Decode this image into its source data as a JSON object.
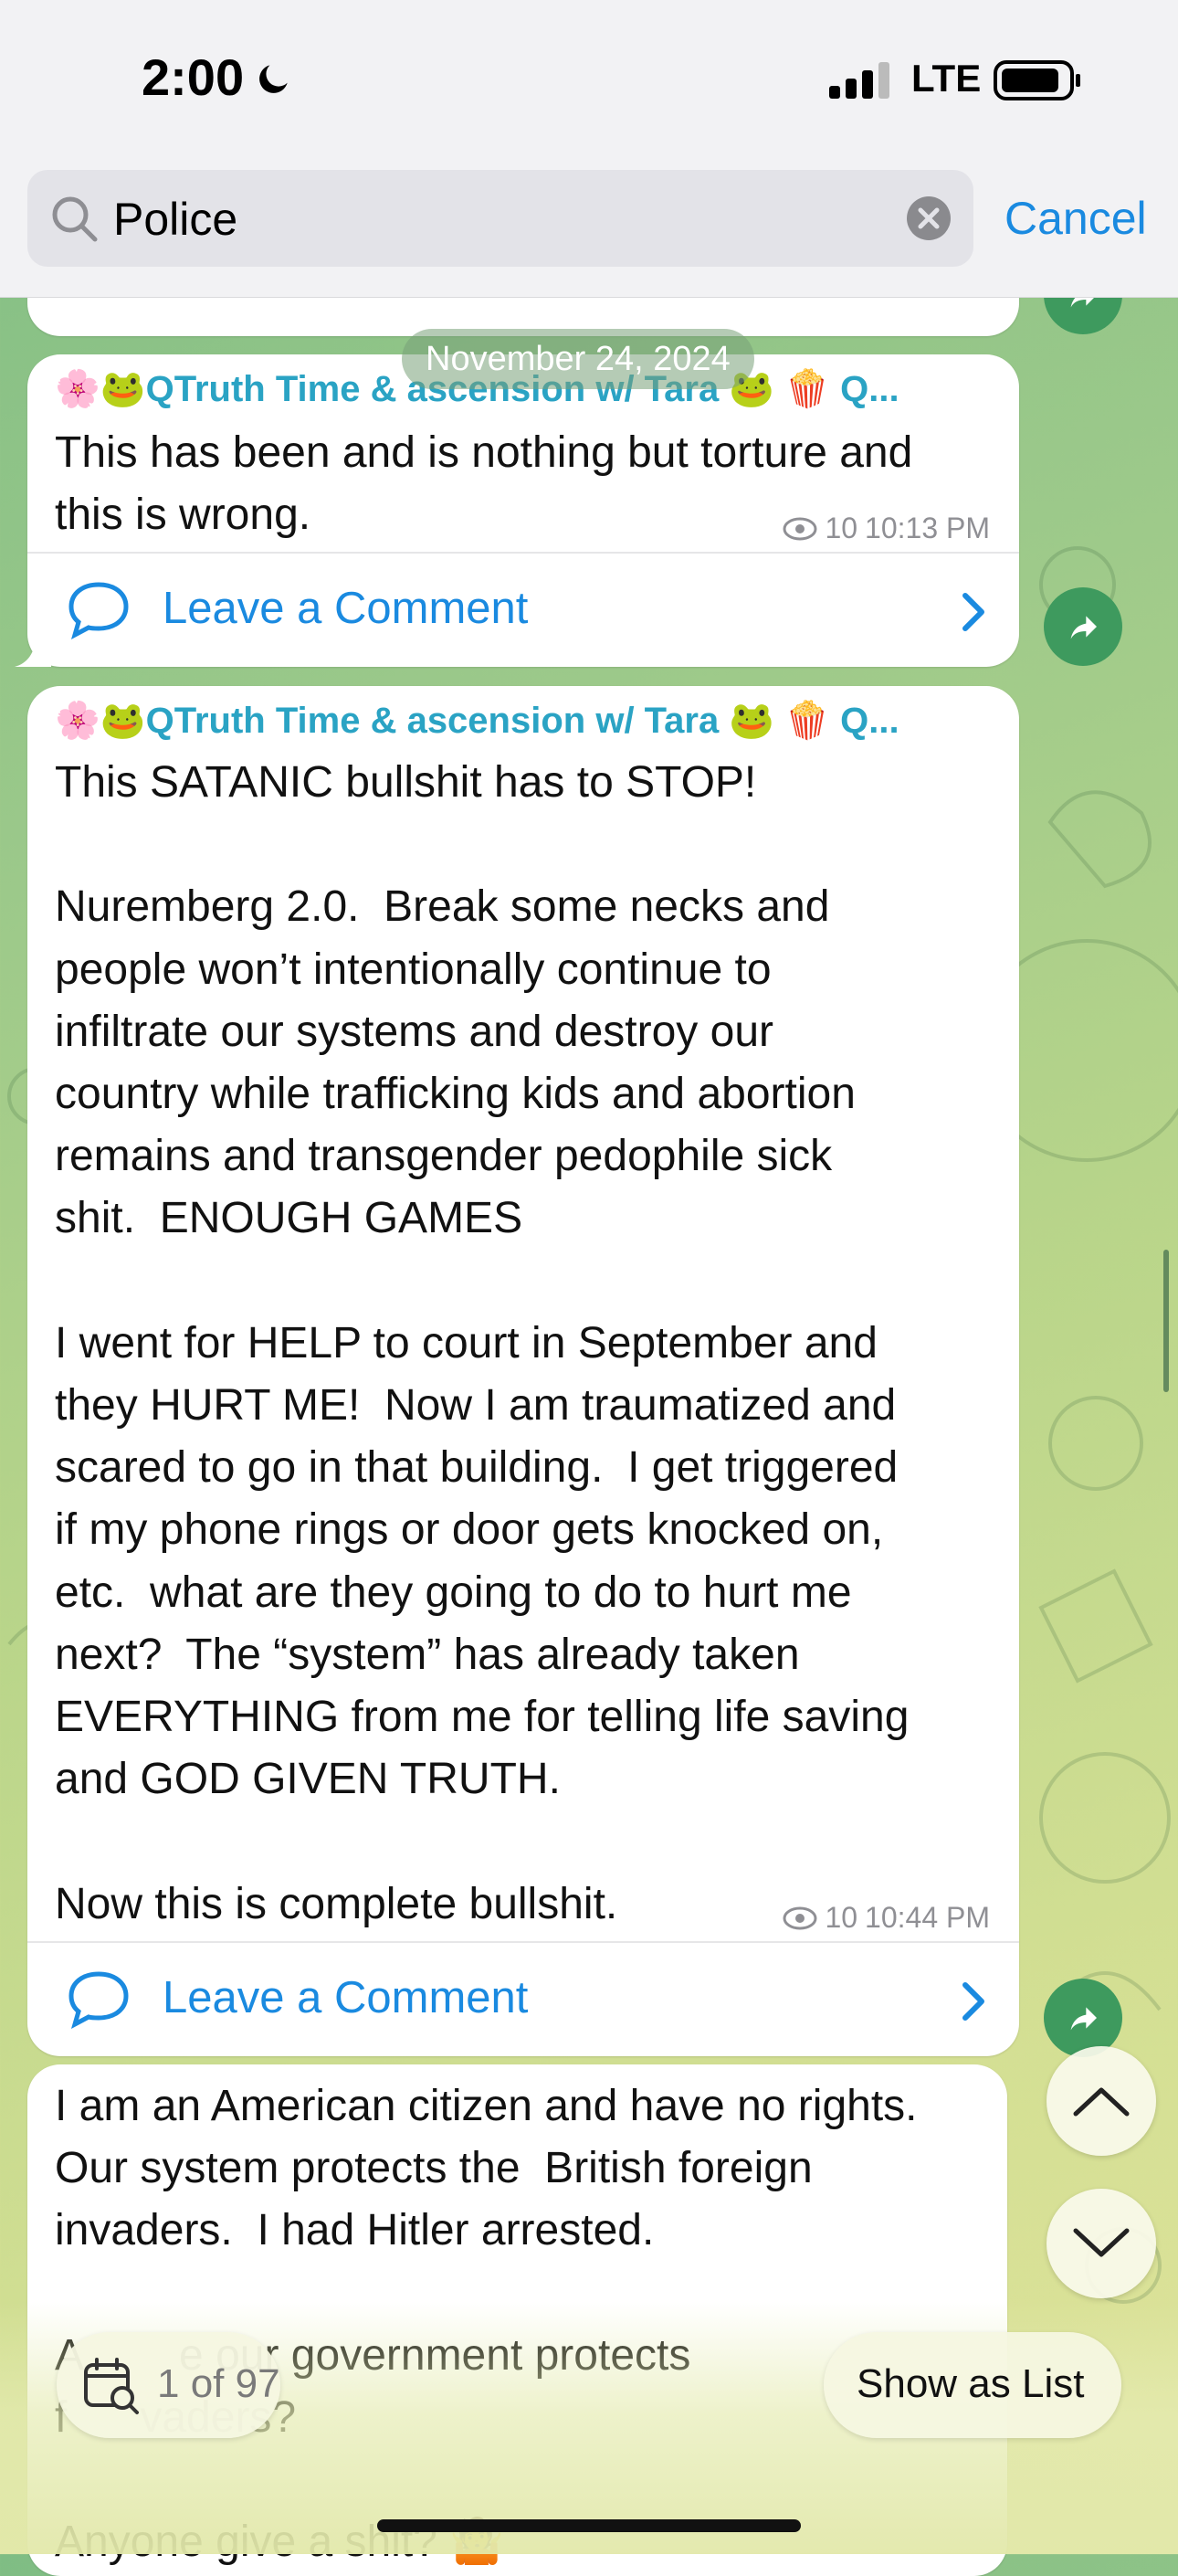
{
  "status_bar": {
    "time": "2:00",
    "network": "LTE"
  },
  "search": {
    "value": "Police",
    "placeholder": "Search",
    "cancel_label": "Cancel"
  },
  "date_pill": "November 24, 2024",
  "messages": [
    {
      "sender": "🌸🐸QTruth Time & ascension w/ Tara 🐸 🍿 Q...",
      "text": "This has been and is nothing but torture and\nthis is wrong.",
      "views": "10",
      "time": "10:13 PM",
      "comment_label": "Leave a Comment"
    },
    {
      "sender": "🌸🐸QTruth Time & ascension w/ Tara 🐸 🍿 Q...",
      "text": "This SATANIC bullshit has to STOP!\n\nNuremberg 2.0.  Break some necks and\npeople won’t intentionally continue to\ninfiltrate our systems and destroy our\ncountry while trafficking kids and abortion\nremains and transgender pedophile sick\nshit.  ENOUGH GAMES\n\nI went for HELP to court in September and\nthey HURT ME!  Now I am traumatized and\nscared to go in that building.  I get triggered\nif my phone rings or door gets knocked on,\netc.  what are they going to do to hurt me\nnext?  The “system” has already taken\nEVERYTHING from me for telling life saving\nand GOD GIVEN TRUTH.\n\nNow this is complete bullshit.",
      "views": "10",
      "time": "10:44 PM",
      "comment_label": "Leave a Comment"
    },
    {
      "text": "I am an American citizen and have no rights.\nOur system protects the  British foreign\ninvaders.  I had Hitler arrested.\n\nA        e our government protects\nf      vaders?\n\nAnyone give a shit? 🤷"
    }
  ],
  "search_results": {
    "counter": "1 of 97",
    "show_as_list_label": "Show as List"
  },
  "colors": {
    "accent": "#1a8ae0",
    "sender": "#2aa3c4",
    "share": "#3e9a5e"
  }
}
